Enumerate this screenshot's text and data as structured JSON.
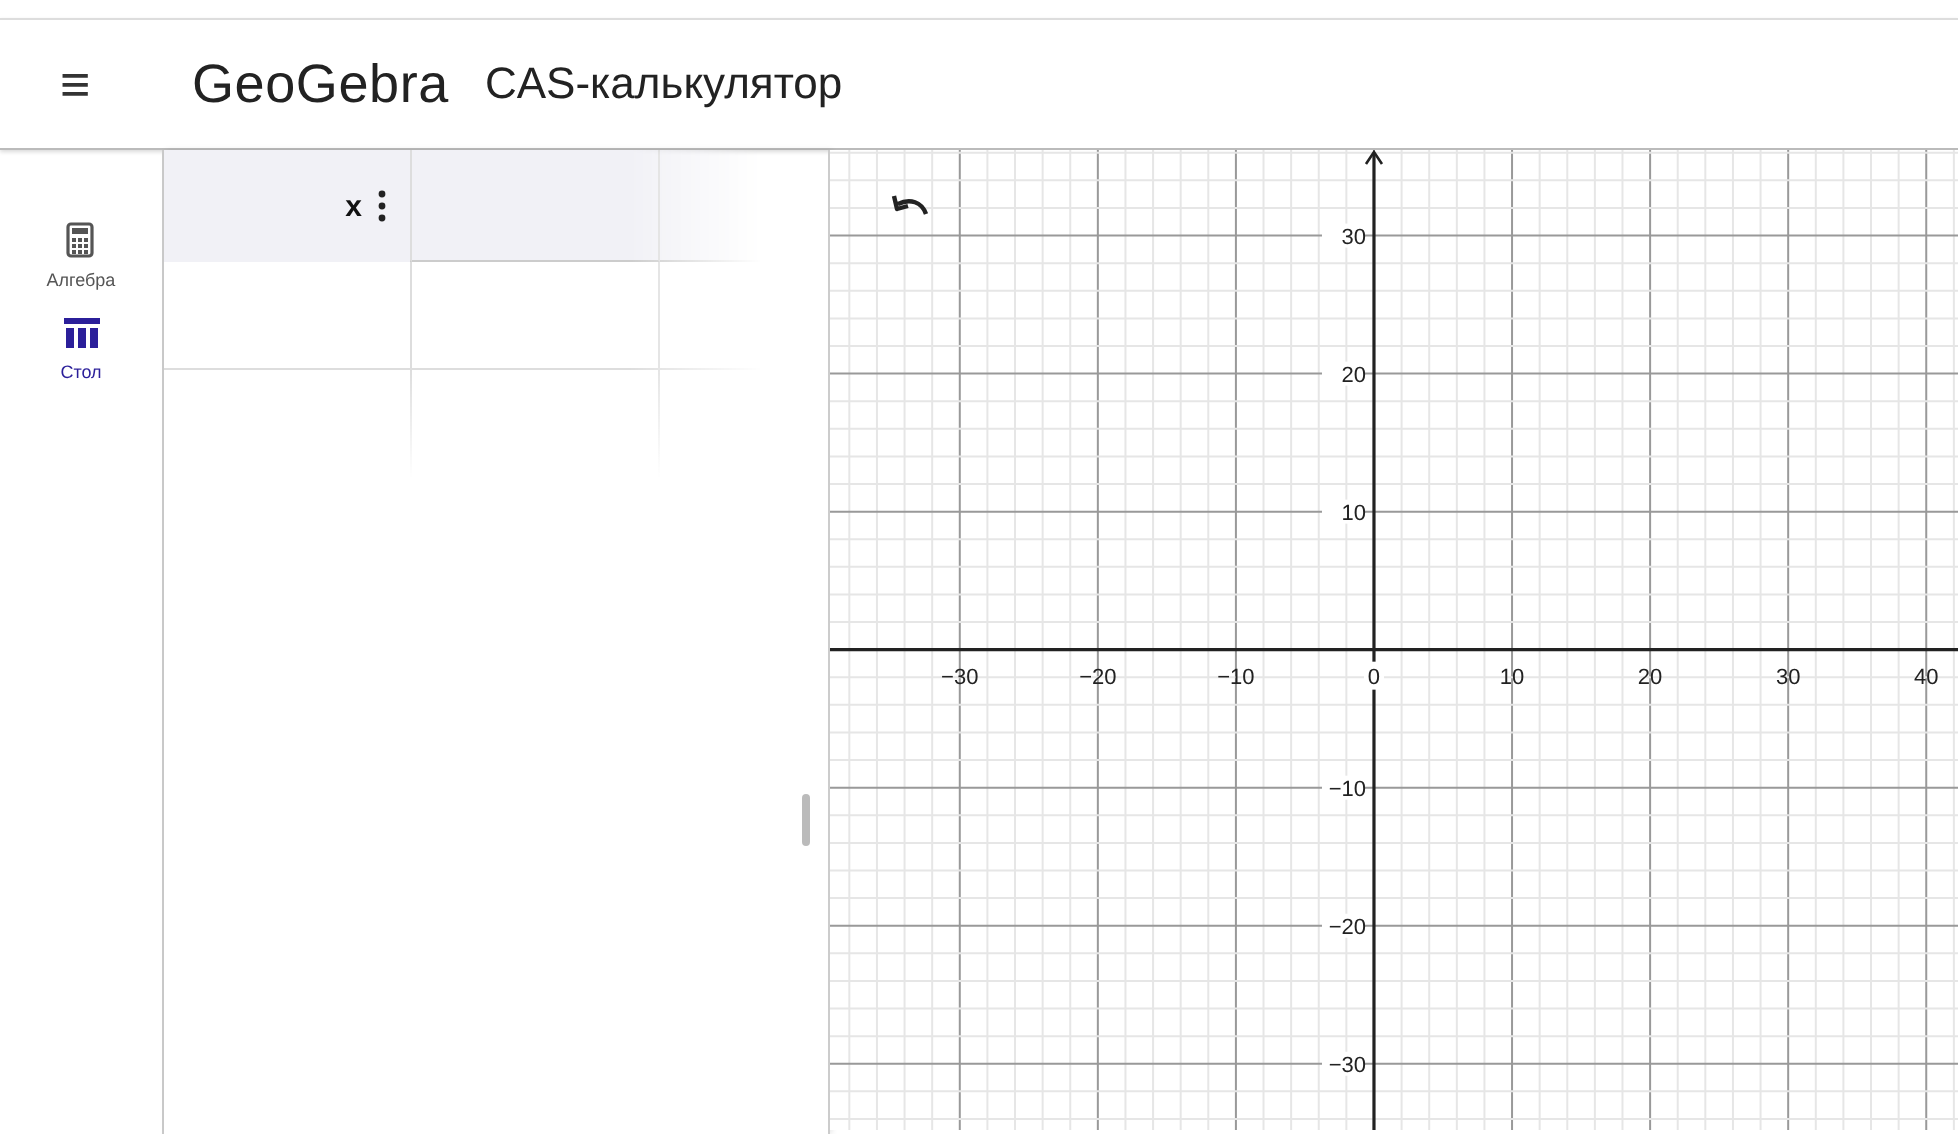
{
  "header": {
    "menu_icon": "≡",
    "logo": "GeoGebra",
    "app_title": "CAS-калькулятор"
  },
  "sidebar": {
    "items": [
      {
        "label": "Алгебра",
        "kind": "calculator",
        "selected": false
      },
      {
        "label": "Стол",
        "kind": "table",
        "selected": true
      }
    ]
  },
  "table": {
    "columns": [
      {
        "heading": "x"
      }
    ]
  },
  "graphics": {
    "chart_data": {
      "type": "line",
      "grid": true,
      "xlim": [
        -39.4,
        42.3
      ],
      "ylim": [
        -34.8,
        36.2
      ],
      "xticks": [
        {
          "value": -30,
          "label": "−30"
        },
        {
          "value": -20,
          "label": "−20"
        },
        {
          "value": -10,
          "label": "−10"
        },
        {
          "value": 0,
          "label": "0"
        },
        {
          "value": 10,
          "label": "10"
        },
        {
          "value": 20,
          "label": "20"
        },
        {
          "value": 30,
          "label": "30"
        },
        {
          "value": 40,
          "label": "40"
        }
      ],
      "yticks": [
        {
          "value": 30,
          "label": "30"
        },
        {
          "value": 20,
          "label": "20"
        },
        {
          "value": 10,
          "label": "10"
        },
        {
          "value": -10,
          "label": "−10"
        },
        {
          "value": -20,
          "label": "−20"
        },
        {
          "value": -30,
          "label": "−30"
        }
      ]
    }
  }
}
